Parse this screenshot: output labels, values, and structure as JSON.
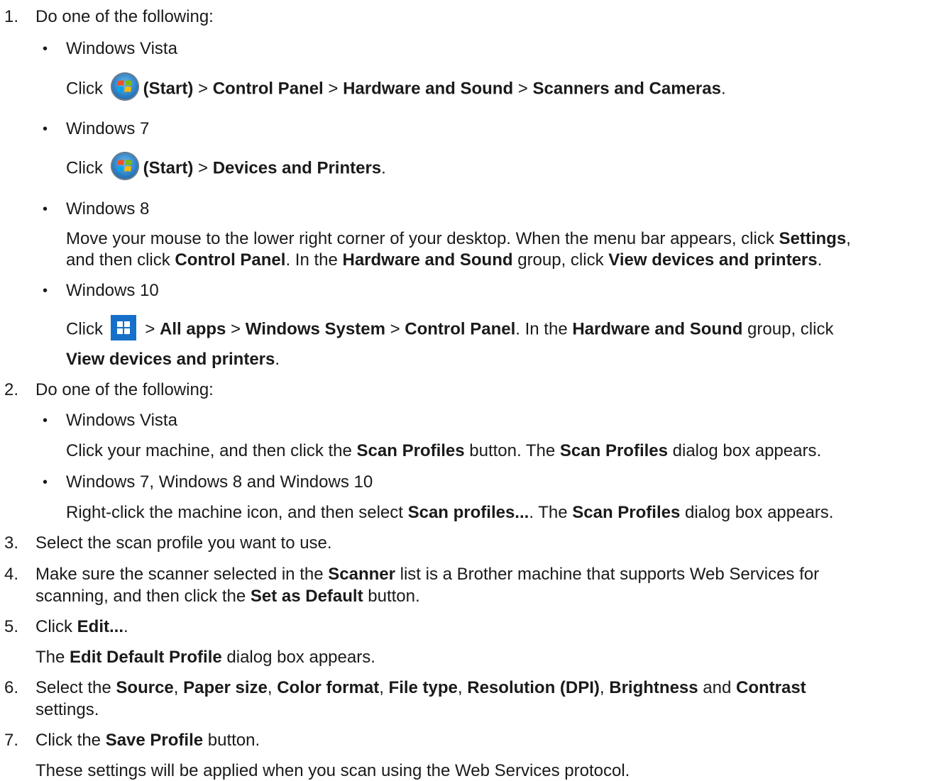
{
  "steps": [
    {
      "num": "1.",
      "text": "Do one of the following:",
      "items": [
        {
          "label": "Windows Vista",
          "desc": [
            "Click ",
            {
              "icon": "windows-start-orb-icon"
            },
            {
              "b": "(Start)"
            },
            " > ",
            {
              "b": "Control Panel"
            },
            " > ",
            {
              "b": "Hardware and Sound"
            },
            " > ",
            {
              "b": "Scanners and Cameras"
            },
            "."
          ]
        },
        {
          "label": "Windows 7",
          "desc": [
            "Click ",
            {
              "icon": "windows-start-orb-icon"
            },
            {
              "b": "(Start)"
            },
            " > ",
            {
              "b": "Devices and Printers"
            },
            "."
          ]
        },
        {
          "label": "Windows 8",
          "desc": [
            "Move your mouse to the lower right corner of your desktop. When the menu bar appears, click ",
            {
              "b": "Settings"
            },
            ","
          ],
          "desc2": [
            "and then click ",
            {
              "b": "Control Panel"
            },
            ". In the ",
            {
              "b": "Hardware and Sound"
            },
            " group, click ",
            {
              "b": "View devices and printers"
            },
            "."
          ]
        },
        {
          "label": "Windows 10",
          "desc": [
            "Click ",
            {
              "icon": "windows-10-start-icon"
            },
            " > ",
            {
              "b": "All apps"
            },
            " > ",
            {
              "b": "Windows System"
            },
            " > ",
            {
              "b": "Control Panel"
            },
            ". In the ",
            {
              "b": "Hardware and Sound"
            },
            " group, click"
          ],
          "desc2": [
            {
              "b": "View devices and printers"
            },
            "."
          ]
        }
      ]
    },
    {
      "num": "2.",
      "text": "Do one of the following:",
      "items": [
        {
          "label": "Windows Vista",
          "desc": [
            "Click your machine, and then click the ",
            {
              "b": "Scan Profiles"
            },
            " button. The ",
            {
              "b": "Scan Profiles"
            },
            " dialog box appears."
          ]
        },
        {
          "label": "Windows 7, Windows 8 and Windows 10",
          "desc": [
            "Right-click the machine icon, and then select ",
            {
              "b": "Scan profiles..."
            },
            ". The ",
            {
              "b": "Scan Profiles"
            },
            " dialog box appears."
          ]
        }
      ]
    },
    {
      "num": "3.",
      "text": [
        "Select the scan profile you want to use."
      ]
    },
    {
      "num": "4.",
      "text": [
        "Make sure the scanner selected in the ",
        {
          "b": "Scanner"
        },
        " list is a Brother machine that supports Web Services for"
      ],
      "text2": [
        "scanning, and then click the ",
        {
          "b": "Set as Default"
        },
        " button."
      ]
    },
    {
      "num": "5.",
      "text": [
        "Click ",
        {
          "b": "Edit..."
        },
        "."
      ],
      "note": [
        "The ",
        {
          "b": "Edit Default Profile"
        },
        " dialog box appears."
      ]
    },
    {
      "num": "6.",
      "text": [
        "Select the ",
        {
          "b": "Source"
        },
        ", ",
        {
          "b": "Paper size"
        },
        ", ",
        {
          "b": "Color format"
        },
        ", ",
        {
          "b": "File type"
        },
        ", ",
        {
          "b": "Resolution (DPI)"
        },
        ", ",
        {
          "b": "Brightness"
        },
        " and ",
        {
          "b": "Contrast"
        }
      ],
      "text2": [
        "settings."
      ]
    },
    {
      "num": "7.",
      "text": [
        "Click the ",
        {
          "b": "Save Profile"
        },
        " button."
      ],
      "note": [
        "These settings will be applied when you scan using the Web Services protocol."
      ]
    }
  ],
  "bullet_glyph": "•",
  "colors": {
    "win_orb": "#2a7fc4",
    "win10_tile": "#1670c9"
  }
}
